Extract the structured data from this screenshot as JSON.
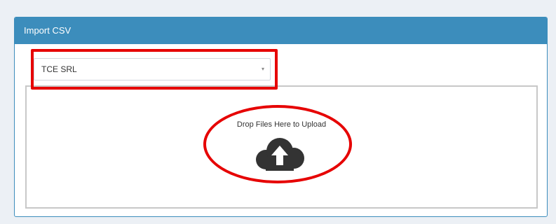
{
  "panel": {
    "title": "Import CSV"
  },
  "select": {
    "value": "TCE SRL",
    "arrow": "▾"
  },
  "dropzone": {
    "text": "Drop Files Here to Upload",
    "icon": "cloud-upload-icon"
  },
  "annotations": {
    "color": "#e60000",
    "shapes": [
      "rectangle around select",
      "ellipse around upload prompt"
    ]
  },
  "colors": {
    "header": "#3c8dbc",
    "background": "#ecf0f5",
    "icon": "#333333"
  }
}
